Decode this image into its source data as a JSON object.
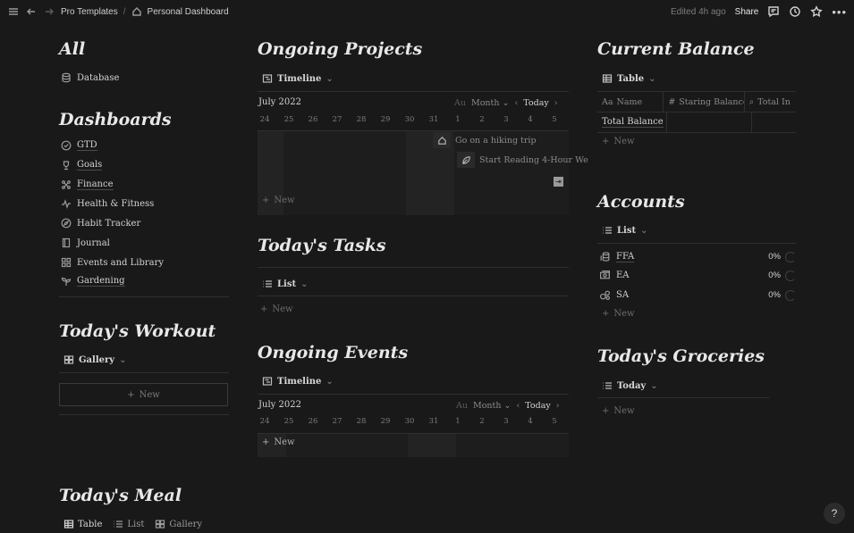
{
  "topbar": {
    "breadcrumb": [
      "Pro Templates",
      "Personal Dashboard"
    ],
    "edited": "Edited 4h ago",
    "share": "Share"
  },
  "left": {
    "all_title": "All",
    "database_label": "Database",
    "dashboards_title": "Dashboards",
    "dashboards": [
      "GTD",
      "Goals",
      "Finance",
      "Health & Fitness",
      "Habit Tracker",
      "Journal",
      "Events and Library",
      "Gardening"
    ],
    "workout_title": "Today's Workout",
    "workout_view": "Gallery",
    "new_label": "New",
    "meal_title": "Today's Meal",
    "meal_tabs": [
      "Table",
      "List",
      "Gallery"
    ]
  },
  "middle": {
    "projects_title": "Ongoing Projects",
    "timeline_view": "Timeline",
    "month_label": "July 2022",
    "au_label": "Au",
    "month_select": "Month",
    "today_label": "Today",
    "days": [
      "24",
      "25",
      "26",
      "27",
      "28",
      "29",
      "30",
      "31",
      "1",
      "2",
      "3",
      "4",
      "5"
    ],
    "projects": [
      "Go on a hiking trip",
      "Start Reading 4-Hour We"
    ],
    "new_label": "New",
    "tasks_title": "Today's Tasks",
    "tasks_view": "List",
    "events_title": "Ongoing Events",
    "events_view": "Timeline"
  },
  "right": {
    "balance_title": "Current Balance",
    "balance_view": "Table",
    "columns": [
      "Name",
      "Staring Balance",
      "Total In"
    ],
    "balance_row": "Total Balance",
    "new_label": "New",
    "accounts_title": "Accounts",
    "accounts_view": "List",
    "accounts": [
      {
        "name": "FFA",
        "pct": "0%"
      },
      {
        "name": "EA",
        "pct": "0%"
      },
      {
        "name": "SA",
        "pct": "0%"
      }
    ],
    "groceries_title": "Today's Groceries",
    "groceries_view": "Today"
  },
  "help": "?"
}
